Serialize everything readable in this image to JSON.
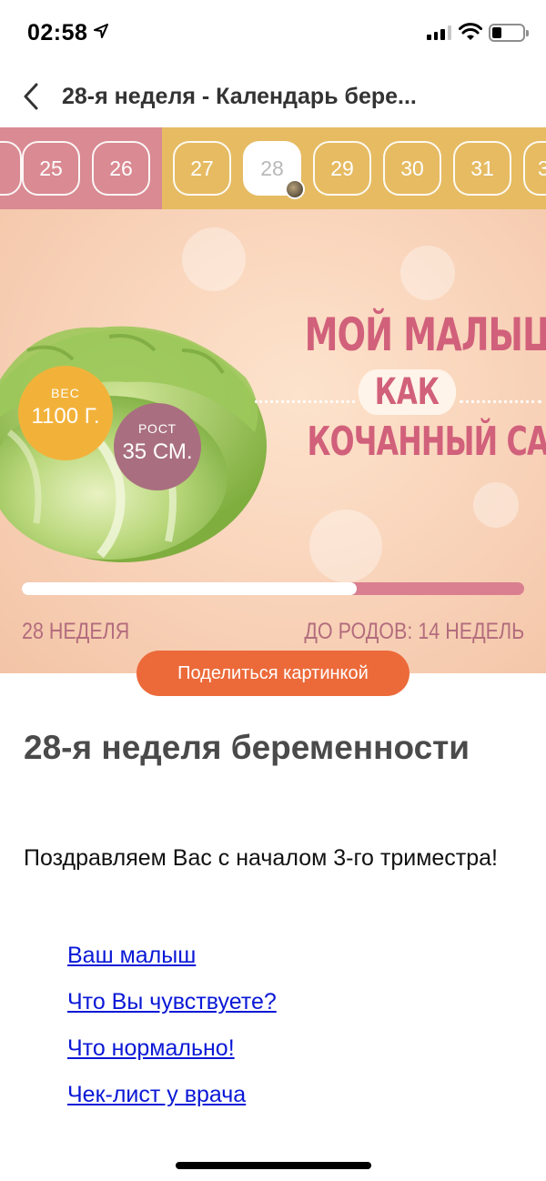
{
  "status_bar": {
    "time": "02:58"
  },
  "nav": {
    "title": "28-я неделя - Календарь бере..."
  },
  "weeks": {
    "items": [
      "25",
      "26",
      "27",
      "28",
      "29",
      "30",
      "31",
      "3"
    ],
    "active": "28",
    "colors": {
      "past": "#d98a92",
      "current": "#e6bb62"
    }
  },
  "banner": {
    "weight_label": "ВЕС",
    "weight_value": "1100 Г.",
    "height_label": "РОСТ",
    "height_value": "35 СМ.",
    "headline_line1": "МОЙ МАЛЫШ",
    "headline_kak": "КАК",
    "headline_line3": "КОЧАННЫЙ САЛАТ",
    "progress_fraction": 0.667,
    "week_caption": "28 НЕДЕЛЯ",
    "due_caption": "ДО РОДОВ: 14 НЕДЕЛЬ"
  },
  "share": {
    "label": "Поделиться картинкой"
  },
  "article": {
    "title": "28-я неделя беременности",
    "intro": "Поздравляем Вас с началом 3-го триместра!",
    "links": [
      "Ваш малыш",
      "Что Вы чувствуете?",
      "Что нормально!",
      "Чек-лист у врача"
    ]
  }
}
